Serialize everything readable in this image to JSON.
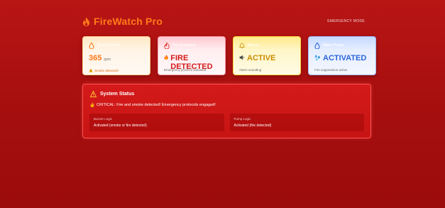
{
  "header": {
    "title": "FireWatch Pro",
    "title_icon": "flame-icon",
    "mode_label": "EMERGENCY MODE"
  },
  "cards": [
    {
      "id": "smoke",
      "icon": "droplet-icon",
      "label": "Smoke Level",
      "value": "365",
      "unit": "ppm",
      "note_icon": "warning-icon",
      "note": "Smoke detected!"
    },
    {
      "id": "fire",
      "icon": "flame-icon",
      "label": "Fire Detection",
      "value": "FIRE DETECTED",
      "value_icon": "flame-icon",
      "note": "Emergency protocol activated"
    },
    {
      "id": "buzzer",
      "icon": "bell-icon",
      "label": "Buzzer",
      "value": "ACTIVE",
      "value_icon": "speaker-icon",
      "note": "Alarm sounding"
    },
    {
      "id": "pump",
      "icon": "droplet-icon",
      "label": "Water Pump",
      "value": "ACTIVATED",
      "value_icon": "sprinkle-icon",
      "note": "Fire suppression active"
    }
  ],
  "status": {
    "title": "System Status",
    "title_icon": "warning-icon",
    "critical_icon": "flame-icon",
    "critical_text": "CRITICAL: Fire and smoke detected! Emergency protocols engaged!",
    "logic": [
      {
        "label": "Buzzer Logic",
        "value": "Activated (smoke or fire detected)"
      },
      {
        "label": "Pump Logic",
        "value": "Activated (fire detected)"
      }
    ]
  },
  "colors": {
    "background": "#b81515",
    "brand": "#ff7a1a",
    "fire_text": "#d51b1b",
    "buzzer_text": "#c98e00",
    "pump_text": "#2b66d8",
    "panel_border": "#ff5656"
  }
}
